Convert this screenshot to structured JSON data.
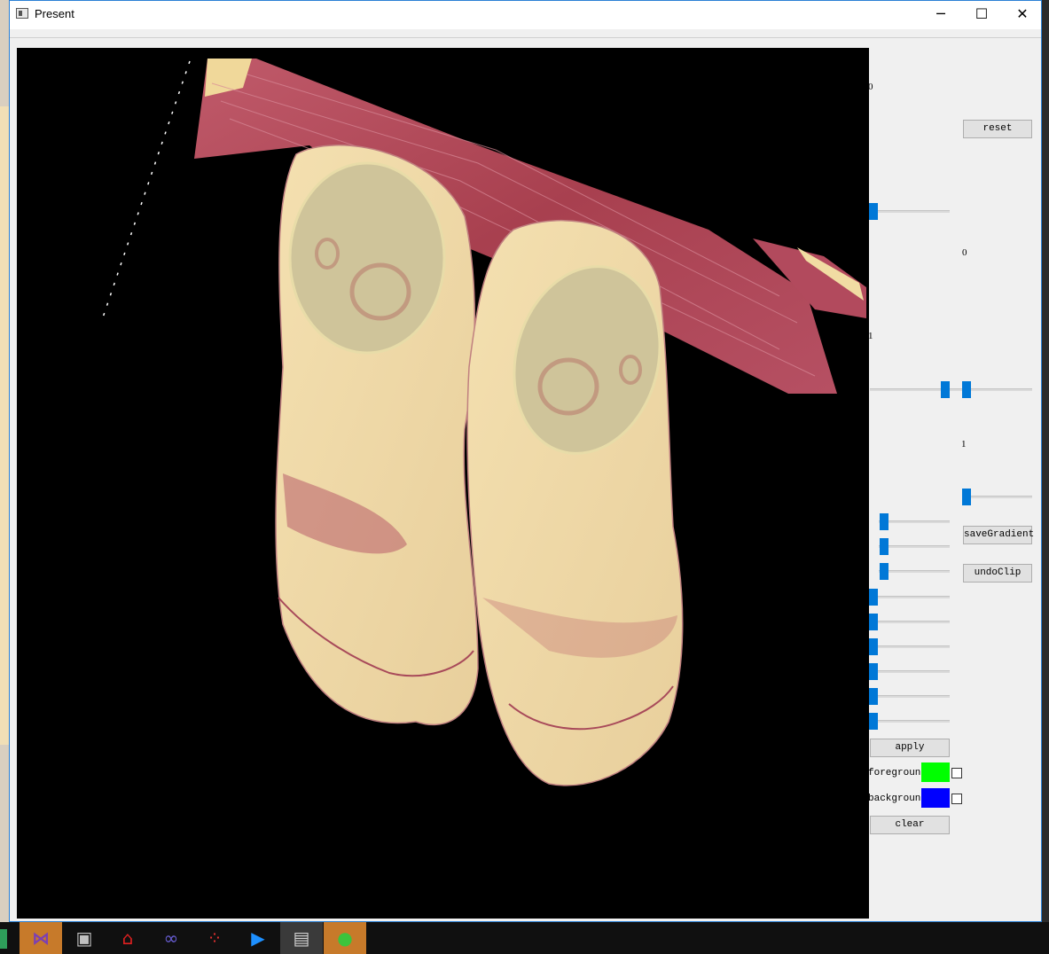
{
  "window": {
    "title": "Present",
    "minimize_glyph": "─",
    "maximize_glyph": "☐",
    "close_glyph": "✕"
  },
  "viewport": {
    "content": "volume-rendering"
  },
  "controls": {
    "number_labels": [
      "0",
      "0",
      "1",
      "1"
    ],
    "reset_label": "reset",
    "save_gradient_label": "saveGradient",
    "undo_clip_label": "undoClip",
    "apply_label": "apply",
    "clear_label": "clear",
    "foreground_label": "foreground",
    "background_label": "background",
    "foreground_color": "#00ff00",
    "background_color": "#0000ff",
    "accent_color": "#0078d7"
  },
  "taskbar": {
    "icons": [
      "visual-studio-icon",
      "image-viewer-icon",
      "pdf-reader-icon",
      "infinity-app-icon",
      "dots-app-icon",
      "media-player-icon",
      "present-app-icon",
      "wechat-icon"
    ]
  }
}
